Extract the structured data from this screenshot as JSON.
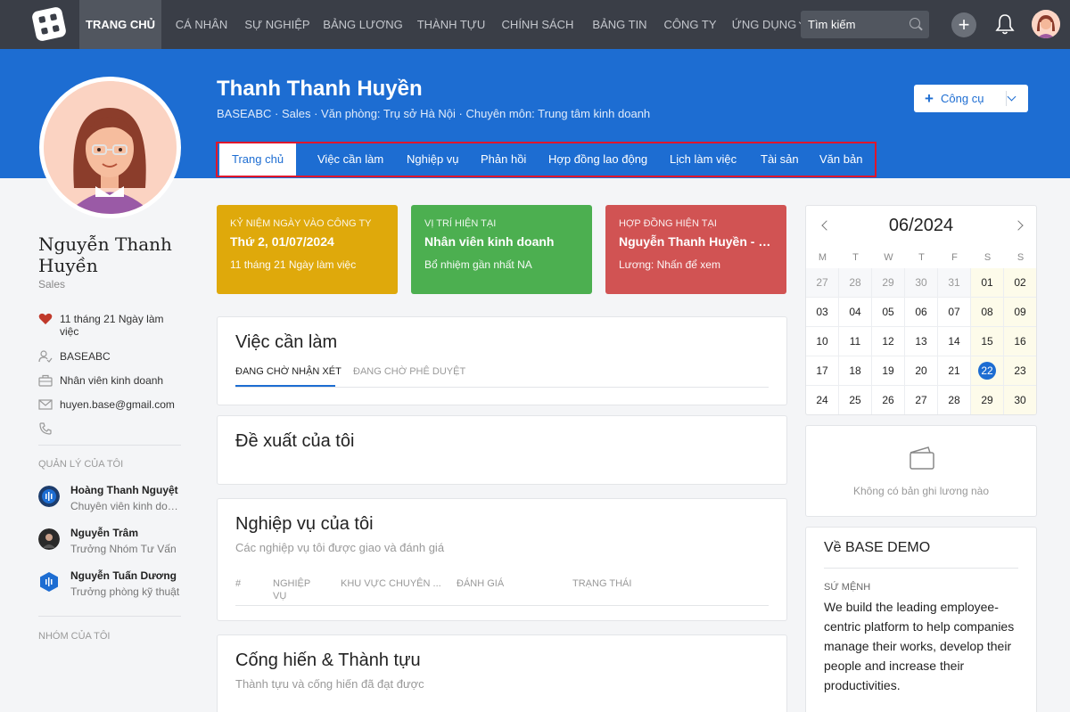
{
  "nav": {
    "items": [
      "TRANG CHỦ",
      "CÁ NHÂN",
      "SỰ NGHIỆP",
      "BẢNG LƯƠNG",
      "THÀNH TỰU",
      "CHÍNH SÁCH",
      "BẢNG TIN",
      "CÔNG TY",
      "ỨNG DỤNG"
    ],
    "search_placeholder": "Tìm kiếm"
  },
  "header": {
    "name": "Thanh Thanh Huyền",
    "subtitle": "BASEABC · Sales · Văn phòng: Trụ sở Hà Nội · Chuyên môn: Trung tâm kinh doanh",
    "tools_button": "Công cụ",
    "tabs": [
      "Trang chủ",
      "Việc cần làm",
      "Nghiệp vụ",
      "Phản hồi",
      "Hợp đồng lao động",
      "Lịch làm việc",
      "Tài sản",
      "Văn bản"
    ]
  },
  "profile": {
    "name": "Nguyễn Thanh Huyền",
    "role": "Sales",
    "tenure": "11 tháng 21 Ngày làm việc",
    "company": "BASEABC",
    "position": "Nhân viên kinh doanh",
    "email": "huyen.base@gmail.com",
    "managers_title": "QUẢN LÝ CỦA TÔI",
    "managers": [
      {
        "name": "Hoàng Thanh Nguyệt",
        "role": "Chuyên viên kinh doanh"
      },
      {
        "name": "Nguyễn Trâm",
        "role": "Trưởng Nhóm Tư Vấn"
      },
      {
        "name": "Nguyễn Tuấn Dương",
        "role": "Trưởng phòng kỹ thuật"
      }
    ],
    "groups_title": "NHÓM CỦA TÔI"
  },
  "cards": [
    {
      "title": "KỶ NIỆM NGÀY VÀO CÔNG TY",
      "value": "Thứ 2, 01/07/2024",
      "sub": "11 tháng 21 Ngày làm việc",
      "color": "#dfa90b"
    },
    {
      "title": "VỊ TRÍ HIỆN TẠI",
      "value": "Nhân viên kinh doanh",
      "sub": "Bổ nhiệm gần nhất NA",
      "color": "#4caf50"
    },
    {
      "title": "HỢP ĐỒNG HIỆN TẠI",
      "value": "Nguyễn Thanh Huyền - Hợp đồng lao động",
      "sub": "Lương: Nhấn để xem",
      "color": "#d15353"
    }
  ],
  "todo": {
    "title": "Việc cần làm",
    "tabs": [
      "ĐANG CHỜ NHẬN XÉT",
      "ĐANG CHỜ PHÊ DUYỆT"
    ]
  },
  "proposals": {
    "title": "Đề xuất của tôi"
  },
  "duties": {
    "title": "Nghiệp vụ của tôi",
    "subtitle": "Các nghiệp vụ tôi được giao và đánh giá",
    "columns": [
      "#",
      "NGHIỆP VỤ",
      "KHU VỰC CHUYÊN ...",
      "ĐÁNH GIÁ",
      "TRẠNG THÁI"
    ]
  },
  "achievements": {
    "title": "Cống hiến & Thành tựu",
    "subtitle": "Thành tựu và cống hiến đã đạt được"
  },
  "calendar": {
    "month": "06/2024",
    "weekdays": [
      "M",
      "T",
      "W",
      "T",
      "F",
      "S",
      "S"
    ],
    "today": "22",
    "rows": [
      [
        "27",
        "28",
        "29",
        "30",
        "31",
        "01",
        "02"
      ],
      [
        "03",
        "04",
        "05",
        "06",
        "07",
        "08",
        "09"
      ],
      [
        "10",
        "11",
        "12",
        "13",
        "14",
        "15",
        "16"
      ],
      [
        "17",
        "18",
        "19",
        "20",
        "21",
        "22",
        "23"
      ],
      [
        "24",
        "25",
        "26",
        "27",
        "28",
        "29",
        "30"
      ]
    ]
  },
  "salary_empty": "Không có bản ghi lương nào",
  "about": {
    "title": "Về BASE DEMO",
    "mission_label": "SỨ MỆNH",
    "mission": "We build the leading employee-centric platform to help companies manage their works, develop their people and increase their productivities."
  },
  "colors": {
    "nav_bg": "#3a3e47",
    "brand_blue": "#1d6dd2",
    "highlight_red": "#e0162b"
  }
}
